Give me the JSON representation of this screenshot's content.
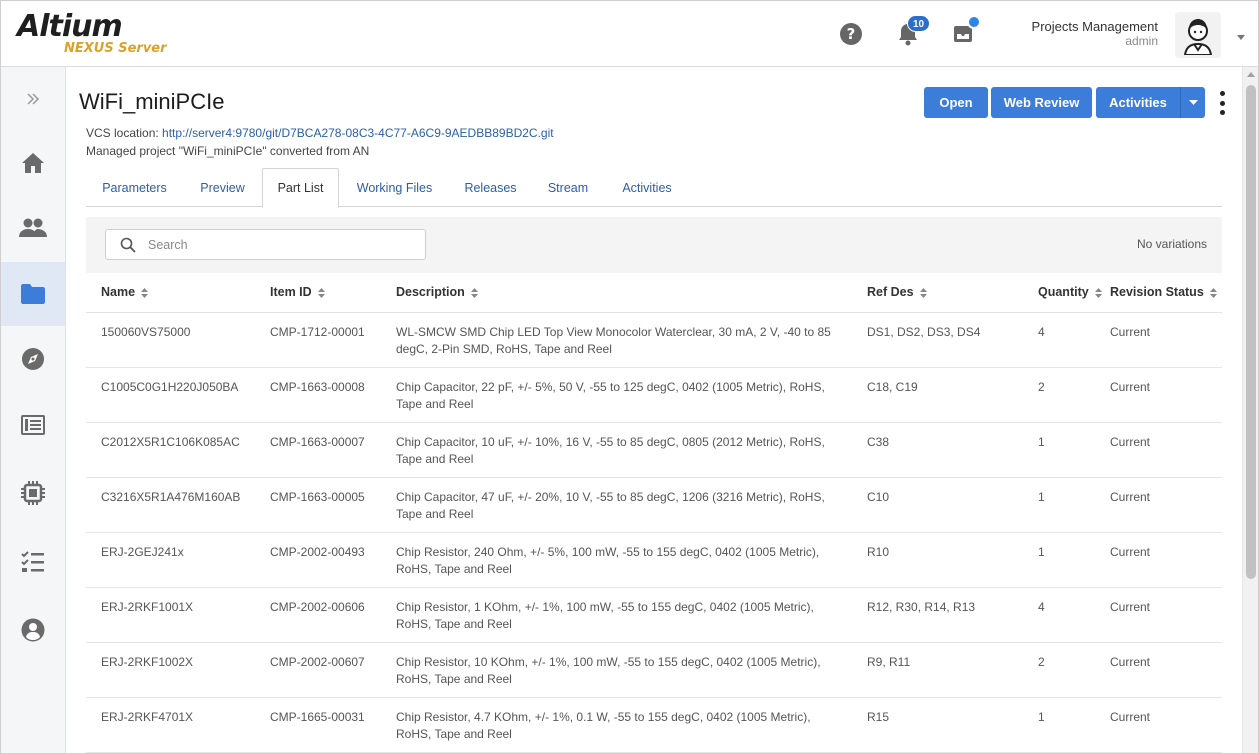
{
  "header": {
    "logo_main": "Altium",
    "logo_sub": "NEXUS Server",
    "notifications_count": "10",
    "org_name": "Projects Management",
    "user_name": "admin"
  },
  "sidebar": {
    "items": [
      {
        "name": "expand",
        "icon": "double-chevron-right-icon"
      },
      {
        "name": "home",
        "icon": "home-icon"
      },
      {
        "name": "users",
        "icon": "users-icon"
      },
      {
        "name": "projects",
        "icon": "folder-icon",
        "active": true
      },
      {
        "name": "explorer",
        "icon": "compass-icon"
      },
      {
        "name": "library",
        "icon": "book-icon"
      },
      {
        "name": "components",
        "icon": "chip-icon"
      },
      {
        "name": "tasks",
        "icon": "checklist-icon"
      },
      {
        "name": "profile",
        "icon": "user-circle-icon"
      }
    ]
  },
  "project": {
    "title": "WiFi_miniPCIe",
    "vcs_label": "VCS location:",
    "vcs_url": "http://server4:9780/git/D7BCA278-08C3-4C77-A6C9-9AEDBB89BD2C.git",
    "managed_note": "Managed project \"WiFi_miniPCIe\" converted from AN"
  },
  "actions": {
    "open": "Open",
    "web_review": "Web Review",
    "activities": "Activities"
  },
  "tabs": [
    {
      "label": "Parameters"
    },
    {
      "label": "Preview"
    },
    {
      "label": "Part List",
      "active": true
    },
    {
      "label": "Working Files"
    },
    {
      "label": "Releases"
    },
    {
      "label": "Stream"
    },
    {
      "label": "Activities"
    }
  ],
  "toolbar": {
    "search_placeholder": "Search",
    "variations": "No variations"
  },
  "table": {
    "columns": [
      "Name",
      "Item ID",
      "Description",
      "Ref Des",
      "Quantity",
      "Revision Status"
    ],
    "rows": [
      [
        "150060VS75000",
        "CMP-1712-00001",
        "WL-SMCW SMD Chip LED Top View Monocolor Waterclear, 30 mA, 2 V, -40 to 85 degC, 2-Pin SMD, RoHS, Tape and Reel",
        "DS1, DS2, DS3, DS4",
        "4",
        "Current"
      ],
      [
        "C1005C0G1H220J050BA",
        "CMP-1663-00008",
        "Chip Capacitor, 22 pF, +/- 5%, 50 V, -55 to 125 degC, 0402 (1005 Metric), RoHS, Tape and Reel",
        "C18, C19",
        "2",
        "Current"
      ],
      [
        "C2012X5R1C106K085AC",
        "CMP-1663-00007",
        "Chip Capacitor, 10 uF, +/- 10%, 16 V, -55 to 85 degC, 0805 (2012 Metric), RoHS, Tape and Reel",
        "C38",
        "1",
        "Current"
      ],
      [
        "C3216X5R1A476M160AB",
        "CMP-1663-00005",
        "Chip Capacitor, 47 uF, +/- 20%, 10 V, -55 to 85 degC, 1206 (3216 Metric), RoHS, Tape and Reel",
        "C10",
        "1",
        "Current"
      ],
      [
        "ERJ-2GEJ241x",
        "CMP-2002-00493",
        "Chip Resistor, 240 Ohm, +/- 5%, 100 mW, -55 to 155 degC, 0402 (1005 Metric), RoHS, Tape and Reel",
        "R10",
        "1",
        "Current"
      ],
      [
        "ERJ-2RKF1001X",
        "CMP-2002-00606",
        "Chip Resistor, 1 KOhm, +/- 1%, 100 mW, -55 to 155 degC, 0402 (1005 Metric), RoHS, Tape and Reel",
        "R12, R30, R14, R13",
        "4",
        "Current"
      ],
      [
        "ERJ-2RKF1002X",
        "CMP-2002-00607",
        "Chip Resistor, 10 KOhm, +/- 1%, 100 mW, -55 to 155 degC, 0402 (1005 Metric), RoHS, Tape and Reel",
        "R9, R11",
        "2",
        "Current"
      ],
      [
        "ERJ-2RKF4701X",
        "CMP-1665-00031",
        "Chip Resistor, 4.7 KOhm, +/- 1%, 0.1 W, -55 to 155 degC, 0402 (1005 Metric), RoHS, Tape and Reel",
        "R15",
        "1",
        "Current"
      ]
    ]
  },
  "colors": {
    "accent": "#3b7dd8",
    "link": "#2a5fa8",
    "logo_sub": "#d9a32b",
    "sidebar_active": "#dfe8f4"
  }
}
